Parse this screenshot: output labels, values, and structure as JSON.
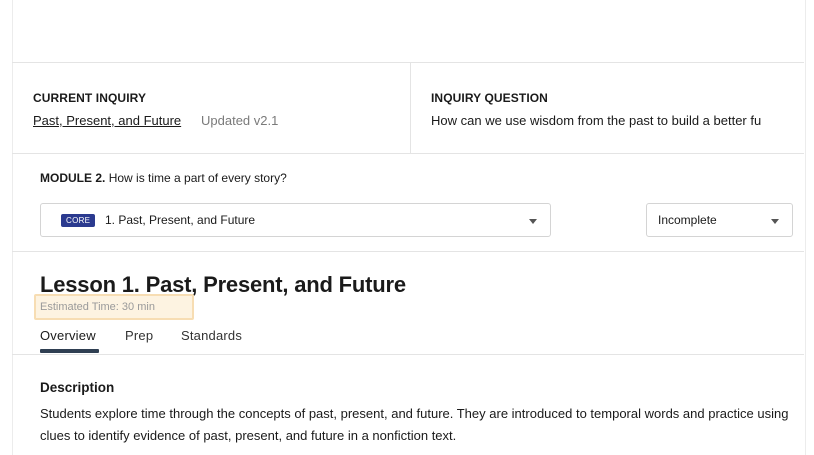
{
  "header": {
    "current_inquiry_label": "CURRENT INQUIRY",
    "inquiry_link": "Past, Present, and Future",
    "updated": "Updated v2.1",
    "inquiry_question_label": "INQUIRY QUESTION",
    "inquiry_question": "How can we use wisdom from the past to build a better fu"
  },
  "module": {
    "label": "MODULE 2.",
    "question": "How is time a part of every story?"
  },
  "lesson_select": {
    "badge": "CORE",
    "value": "1. Past, Present, and Future"
  },
  "status_select": {
    "value": "Incomplete"
  },
  "lesson": {
    "title": "Lesson 1. Past, Present, and Future",
    "estimated_time": "Estimated Time: 30 min"
  },
  "tabs": [
    "Overview",
    "Prep",
    "Standards"
  ],
  "active_tab": "Overview",
  "description": {
    "title": "Description",
    "text": "Students explore time through the concepts of past, present, and future. They are introduced to temporal words and practice using clues to identify evidence of past, present, and future in a nonfiction text."
  },
  "colors": {
    "badge_bg": "#2b3a8f",
    "tab_underline": "#2f3f52",
    "highlight_fill": "#fdf3e1",
    "highlight_border": "#f7ddb3"
  }
}
